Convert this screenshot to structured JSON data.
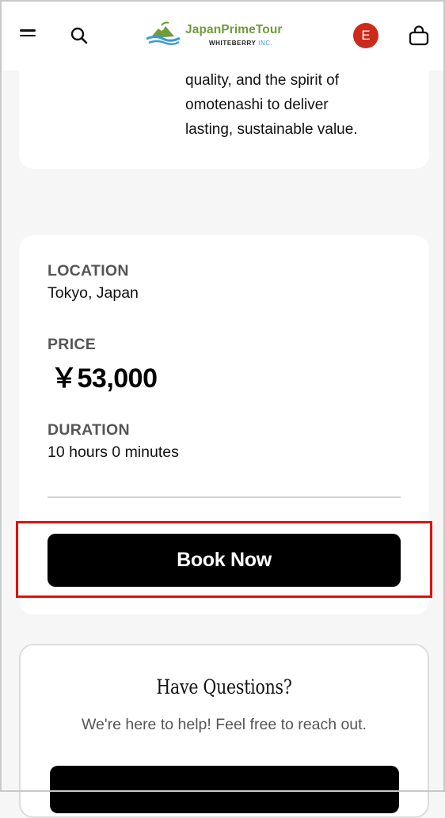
{
  "header": {
    "brand_name": "JapanPrimeTour",
    "brand_company": "WHITEBERRY",
    "brand_company_suffix": "INC.",
    "avatar_initial": "E",
    "icons": [
      "menu-icon",
      "search-icon",
      "shopping-bag-icon"
    ],
    "colors": {
      "brand_green": "#6f9b3c",
      "avatar_bg": "#cc2a1a"
    }
  },
  "intro_card": {
    "lines": [
      "quality, and the spirit of",
      "omotenashi to deliver",
      "lasting, sustainable value."
    ]
  },
  "details": {
    "location_label": "LOCATION",
    "location_value": "Tokyo, Japan",
    "price_label": "PRICE",
    "price_value": "￥53,000",
    "duration_label": "DURATION",
    "duration_value": "10 hours 0 minutes",
    "book_label": "Book Now"
  },
  "questions": {
    "title": "Have Questions?",
    "subtitle": "We're here to help! Feel free to reach out."
  }
}
